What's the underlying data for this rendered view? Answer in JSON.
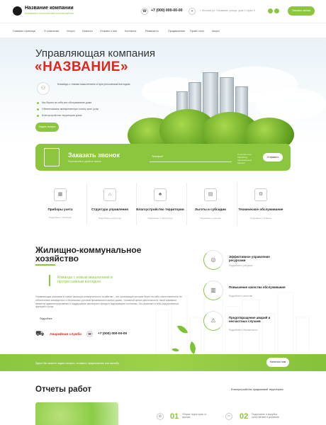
{
  "header": {
    "company_name": "Название компании",
    "company_tagline": "Компания с многолетним опытом работы",
    "phone": "+7 (000) 000-00-00",
    "address": "г. Москва ул. Название улицы, дом 0 офис 0",
    "cta_label": "Заказать звонок",
    "social_count": 3
  },
  "nav": {
    "items": [
      "Главная страница",
      "О компании",
      "Услуги",
      "Новости",
      "Отзывы о нас",
      "Контакты",
      "Реквизиты",
      "Продвижение",
      "Прайс-лист",
      "Акции"
    ]
  },
  "hero": {
    "title_line1": "Управляющая компания",
    "title_line2": "«НАЗВАНИЕ»",
    "quote": "Команда с новым мышлением и прогрессивным взглядом",
    "bullets": [
      "Мы берем на себя все обслуживание дома",
      "Обеспечиваем своевременную оплату всех услуг",
      "Благоустройство территории дома"
    ],
    "button_label": "Задать вопрос"
  },
  "callback": {
    "title": "Заказать звонок",
    "subtitle": "Перезвоним в удобное время",
    "input_placeholder": "Телефон*",
    "consent": "Я согласен на обработку персональных данных",
    "button_label": "Отправить"
  },
  "services": [
    {
      "title": "Приборы учета",
      "subtitle": "Подробнее о приборах",
      "icon": "meter-icon"
    },
    {
      "title": "Структура управления",
      "subtitle": "Подробнее о структуре",
      "icon": "structure-icon"
    },
    {
      "title": "Благоустройство территории",
      "subtitle": "Подробнее о территории",
      "icon": "landscaping-icon"
    },
    {
      "title": "Льготы и субсидии",
      "subtitle": "Подробнее о льготах",
      "icon": "benefits-icon"
    },
    {
      "title": "Техническое обслуживание",
      "subtitle": "Подробнее о сервисе",
      "icon": "maintenance-icon"
    }
  ],
  "housing": {
    "title_line1": "Жилищно-коммунальное",
    "title_line2": "хозяйство",
    "quote": "Команда с новым мышлением и прогрессивным взглядом",
    "paragraph": "Управляющая компания в сфере жилищно-коммунального хозяйства – это организация которая берет на себя ответственность по обеспечению комфортных и безопасных условий проживания в жилых домах. Основной целью деятельности такой компании является администрирование и поддержание жилищного фонда в надлежащем состоянии. Это включает в себя ряд различных функций и услуг.",
    "more_label": "Подробнее",
    "emergency_label": "Аварийная служба",
    "emergency_phone": "+7 (000) 000-00-00",
    "features": [
      {
        "title": "Эффективное управление ресурсами",
        "subtitle": "Подробнее о ресурсах",
        "icon": "resources-icon"
      },
      {
        "title": "Повышение качества обслуживания",
        "subtitle": "Подробнее о качестве",
        "icon": "quality-icon"
      },
      {
        "title": "Предотвращение аварий и несчастных случаев",
        "subtitle": "Подробнее о безопасности",
        "icon": "safety-icon"
      }
    ]
  },
  "band": {
    "text": "Здесь Вы можете задать вопрос, оставить предложение или жалобу",
    "button_label": "Написать нам"
  },
  "reports": {
    "title": "Отчеты работ",
    "link": "Благоустройство придомовой территории",
    "items": [
      {
        "num": "01",
        "label": "Уборка территории от мусора"
      },
      {
        "num": "02",
        "label": "Подрезание и вырубка сухих ветвей и деревьев"
      }
    ]
  },
  "colors": {
    "accent": "#8cc63f",
    "brand_red": "#e0261b"
  }
}
